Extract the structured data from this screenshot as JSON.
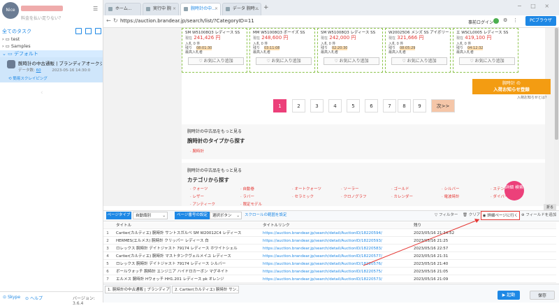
{
  "sidebar": {
    "logo": "Nice Guy",
    "user_sub": "料金を払い足りない？",
    "task_header": "全てのタスク",
    "tree": [
      {
        "label": "test"
      },
      {
        "label": "Samples"
      },
      {
        "label": "デフォルト"
      }
    ],
    "task": {
      "title": "腕時計の中古通販 | ブランディアオークショ...",
      "meta_label": "データ数:",
      "meta_count": "60",
      "meta_date": "2023-05-16 14:30:0",
      "link": "簡易スクレイピング"
    },
    "footer": {
      "skype": "Skype",
      "help": "ヘルプ",
      "version": "バージョン: 3.6.4"
    }
  },
  "browser": {
    "tabs": [
      {
        "label": "ホーム..."
      },
      {
        "label": "実行中 腕時..."
      },
      {
        "label": "腕時計の中..."
      },
      {
        "label": "データ 腕時..."
      }
    ],
    "url": "https://auction.brandear.jp/search/list/?CategoryID=11",
    "login": "事前ログイン",
    "pc_browser": "PCブラウザ"
  },
  "webpage": {
    "cards": [
      {
        "name": "SM W51008Q3 レディース SS",
        "price_label": "現在",
        "price": "241,426 円",
        "in_label": "入札",
        "in_val": "0 件",
        "remain_label": "残り",
        "remain": "08:01:30",
        "bidder_label": "最高入札者",
        "fav": "お気に入り追加"
      },
      {
        "name": "MM W51008Q3 ボーイズ SS",
        "price_label": "現在",
        "price": "248,600 円",
        "in_label": "入札",
        "in_val": "0 件",
        "remain_label": "残り",
        "remain": "03:11:08",
        "bidder_label": "最高入札者",
        "fav": "お気に入り追加"
      },
      {
        "name": "SM W51008Q3 レディース SS",
        "price_label": "現在",
        "price": "242,000 円",
        "in_label": "入札",
        "in_val": "0 件",
        "remain_label": "残り",
        "remain": "02:20:30",
        "bidder_label": "最高入札者",
        "fav": "お気に入り追加"
      },
      {
        "name": "W20025D6 メンズ SS アイボリー",
        "price_label": "現在",
        "price": "321,666 円",
        "in_label": "入札",
        "in_val": "0 件",
        "remain_label": "残り",
        "remain": "08:05:29",
        "bidder_label": "最高入札者",
        "fav": "お気に入り追加"
      },
      {
        "name": "エ WSCL0005 レディース SS",
        "price_label": "現在",
        "price": "419,100 円",
        "in_label": "入札",
        "in_val": "0 件",
        "remain_label": "残り",
        "remain": "04:12:32",
        "bidder_label": "最高入札者",
        "fav": "お気に入り追加"
      }
    ],
    "register": {
      "line1": "腕時計 の",
      "line2": "入荷お知らせ登録",
      "sub": "入荷お知らせとは？"
    },
    "pages": [
      "1",
      "2",
      "3",
      "4",
      "5",
      "6",
      "7",
      "8",
      "9",
      "次>>"
    ],
    "section1_title": "腕時計の中古品をもっと見る",
    "section1_heading": "腕時計のタイプから探す",
    "section1_link": "腕時計",
    "section2_title": "腕時計の中古品をもっと見る",
    "section2_heading": "カテゴリから探す",
    "categories": [
      "クォーツ",
      "自動巻",
      "オートクォーツ",
      "ソーラー",
      "ゴールド",
      "シルバー",
      "ステンレス",
      "レザー",
      "ラバー",
      "セラミック",
      "クロノグラフ",
      "カレンダー",
      "電波時計",
      "ダイバー",
      "アンティーク",
      "限定モデル"
    ],
    "detail_btn": "詳細 検索",
    "fold": "折る"
  },
  "toolbar": {
    "page_type_label": "ページタイプ",
    "page_type_value": "自動識別",
    "page_count_label": "ページ番号の設定",
    "page_count_value": "選択ボタン",
    "scroll_link": "スクロールの範囲を設定",
    "filter": "フィルター",
    "clear": "クリア",
    "goto_detail": "詳細ページに行く",
    "add_field": "フィールドを追加"
  },
  "table": {
    "headers": [
      "タイトル",
      "タイトルリンク",
      "残り"
    ],
    "rows": [
      {
        "n": "1",
        "title": "Cartier(カルティエ) 腕時計 サントスガルベ SM W20012C4 レディース",
        "link": "https://auction.brandear.jp/search/detail/AuctionID/18220594/",
        "remain": "2023/05/16 21:34:52"
      },
      {
        "n": "2",
        "title": "HERMES(エルメス) 腕時計 クリッパー レディース 白",
        "link": "https://auction.brandear.jp/search/detail/AuctionID/18220593/",
        "remain": "2023/05/16 21:25"
      },
      {
        "n": "3",
        "title": "ロレックス 腕時計 デイトジャスト 79174 レディース ホワイトシェル",
        "link": "https://auction.brandear.jp/search/detail/AuctionID/18220583/",
        "remain": "2023/05/16 22:57"
      },
      {
        "n": "4",
        "title": "Cartier(カルティエ) 腕時計 マストタンクヴェルメイユ レディース",
        "link": "https://auction.brandear.jp/search/detail/AuctionID/18220577/",
        "remain": "2023/05/16 21:31"
      },
      {
        "n": "5",
        "title": "ロレックス 腕時計 デイトジャスト 79174 レディース シルバー",
        "link": "https://auction.brandear.jp/search/detail/AuctionID/18220576/",
        "remain": "2023/05/16 21:40"
      },
      {
        "n": "6",
        "title": "ボールウォッチ 腕時計 エンジニア ハイドロカーボン マグネイト",
        "link": "https://auction.brandear.jp/search/detail/AuctionID/18220575/",
        "remain": "2023/05/16 21:05"
      },
      {
        "n": "7",
        "title": "エルメス 腕時計 Hウォッチ HH1.201 レディース pk オレンジ",
        "link": "https://auction.brandear.jp/search/detail/AuctionID/18220573/",
        "remain": "2023/05/16 21:09"
      }
    ]
  },
  "bottom": {
    "tabs": [
      "1. 腕時計の中古通販 | ブランディア...",
      "2. Cartier(カルティエ) 腕時計 サン..."
    ],
    "run": "起動",
    "save": "保存"
  },
  "colors": {
    "accent": "#1e88e5",
    "pink": "#ec407a",
    "orange": "#f39c12",
    "price": "#e53935"
  }
}
